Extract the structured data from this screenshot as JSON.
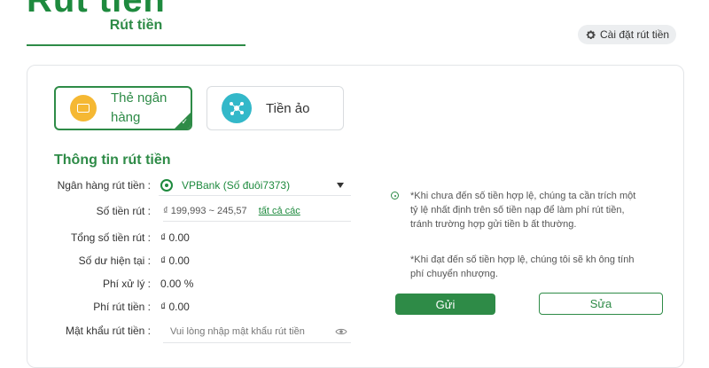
{
  "header": {
    "clipped_title": "Rút tiền"
  },
  "tabs": {
    "active_label": "Rút tiền"
  },
  "settings": {
    "label": "Cài đặt rút tiền",
    "icon": "gear-icon"
  },
  "methods": {
    "bank_label": "Thẻ ngân hàng",
    "crypto_label": "Tiền ảo"
  },
  "form": {
    "title": "Thông tin rút tiền",
    "bank": {
      "label": "Ngân hàng rút tiền :",
      "value": "VPBank (Số đuôi7373)"
    },
    "amount": {
      "label": "Số tiền rút :",
      "range": "₫ 199,993 ~ 245,57",
      "link": "tất cả các"
    },
    "total": {
      "label": "Tổng số tiền rút :",
      "value": "₫ 0.00"
    },
    "balance": {
      "label": "Số dư hiện tại :",
      "value": "₫ 0.00"
    },
    "processing_fee": {
      "label": "Phí xử lý :",
      "value": "0.00 %"
    },
    "withdraw_fee": {
      "label": "Phí rút tiền :",
      "value": "₫ 0.00"
    },
    "password": {
      "label": "Mật khẩu rút tiền :",
      "placeholder": "Vui lòng nhập mật khẩu rút tiền"
    }
  },
  "notes": {
    "note1": "*Khi chưa đến số tiền hợp lệ, chúng ta cần trích một tỷ lệ nhất định trên số tiền nạp để làm phí rút tiền, tránh trường hợp gửi tiền b ất thường.",
    "note2": "*Khi đạt đến số tiền hợp lệ, chúng tôi sẽ kh ông tính phí chuyển nhượng."
  },
  "actions": {
    "send_label": "Gửi",
    "edit_label": "Sửa"
  },
  "colors": {
    "brand": "#2e8b47",
    "bank_icon": "#f5b833",
    "crypto_icon": "#33b8c9"
  }
}
